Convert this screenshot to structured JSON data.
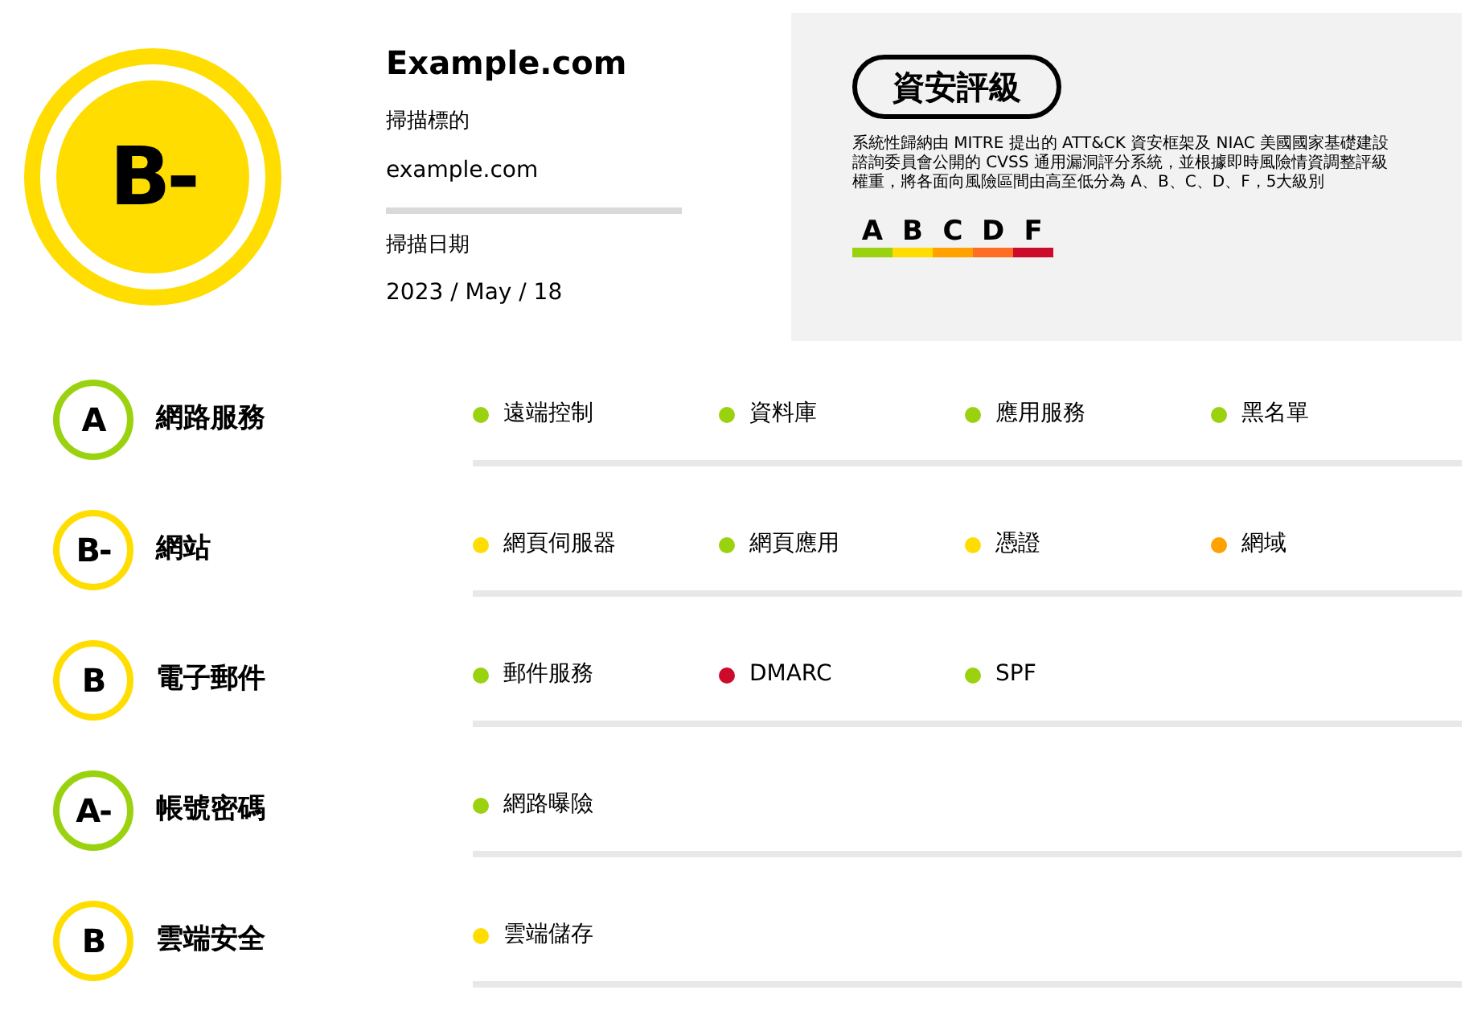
{
  "overall": {
    "grade": "B-",
    "color": "#ffdd00"
  },
  "target": {
    "title": "Example.com",
    "target_label": "掃描標的",
    "target_value": "example.com",
    "date_label": "掃描日期",
    "date_value": "2023 / May / 18"
  },
  "legend": {
    "title": "資安評級",
    "description": "系統性歸納由 MITRE 提出的 ATT&CK 資安框架及 NIAC 美國國家基礎建設諮詢委員會公開的 CVSS 通用漏洞評分系統，並根據即時風險情資調整評級權重，將各面向風險區間由高至低分為 A、B、C、D、F，5大級別",
    "grades": [
      {
        "label": "A",
        "color": "#9bd20f"
      },
      {
        "label": "B",
        "color": "#ffdd00"
      },
      {
        "label": "C",
        "color": "#ffa200"
      },
      {
        "label": "D",
        "color": "#ff6d24"
      },
      {
        "label": "F",
        "color": "#cc0a2a"
      }
    ]
  },
  "categories": [
    {
      "grade": "A",
      "color": "#9bd20f",
      "name": "網路服務",
      "items": [
        {
          "label": "遠端控制",
          "color": "#9bd20f"
        },
        {
          "label": "資料庫",
          "color": "#9bd20f"
        },
        {
          "label": "應用服務",
          "color": "#9bd20f"
        },
        {
          "label": "黑名單",
          "color": "#9bd20f"
        }
      ]
    },
    {
      "grade": "B-",
      "color": "#ffdd00",
      "name": "網站",
      "items": [
        {
          "label": "網頁伺服器",
          "color": "#ffdd00"
        },
        {
          "label": "網頁應用",
          "color": "#9bd20f"
        },
        {
          "label": "憑證",
          "color": "#ffdd00"
        },
        {
          "label": "網域",
          "color": "#ffa200"
        }
      ]
    },
    {
      "grade": "B",
      "color": "#ffdd00",
      "name": "電子郵件",
      "items": [
        {
          "label": "郵件服務",
          "color": "#9bd20f"
        },
        {
          "label": "DMARC",
          "color": "#cc0a2a"
        },
        {
          "label": "SPF",
          "color": "#9bd20f"
        }
      ]
    },
    {
      "grade": "A-",
      "color": "#9bd20f",
      "name": "帳號密碼",
      "items": [
        {
          "label": "網路曝險",
          "color": "#9bd20f"
        }
      ]
    },
    {
      "grade": "B",
      "color": "#ffdd00",
      "name": "雲端安全",
      "items": [
        {
          "label": "雲端儲存",
          "color": "#ffdd00"
        }
      ]
    }
  ]
}
